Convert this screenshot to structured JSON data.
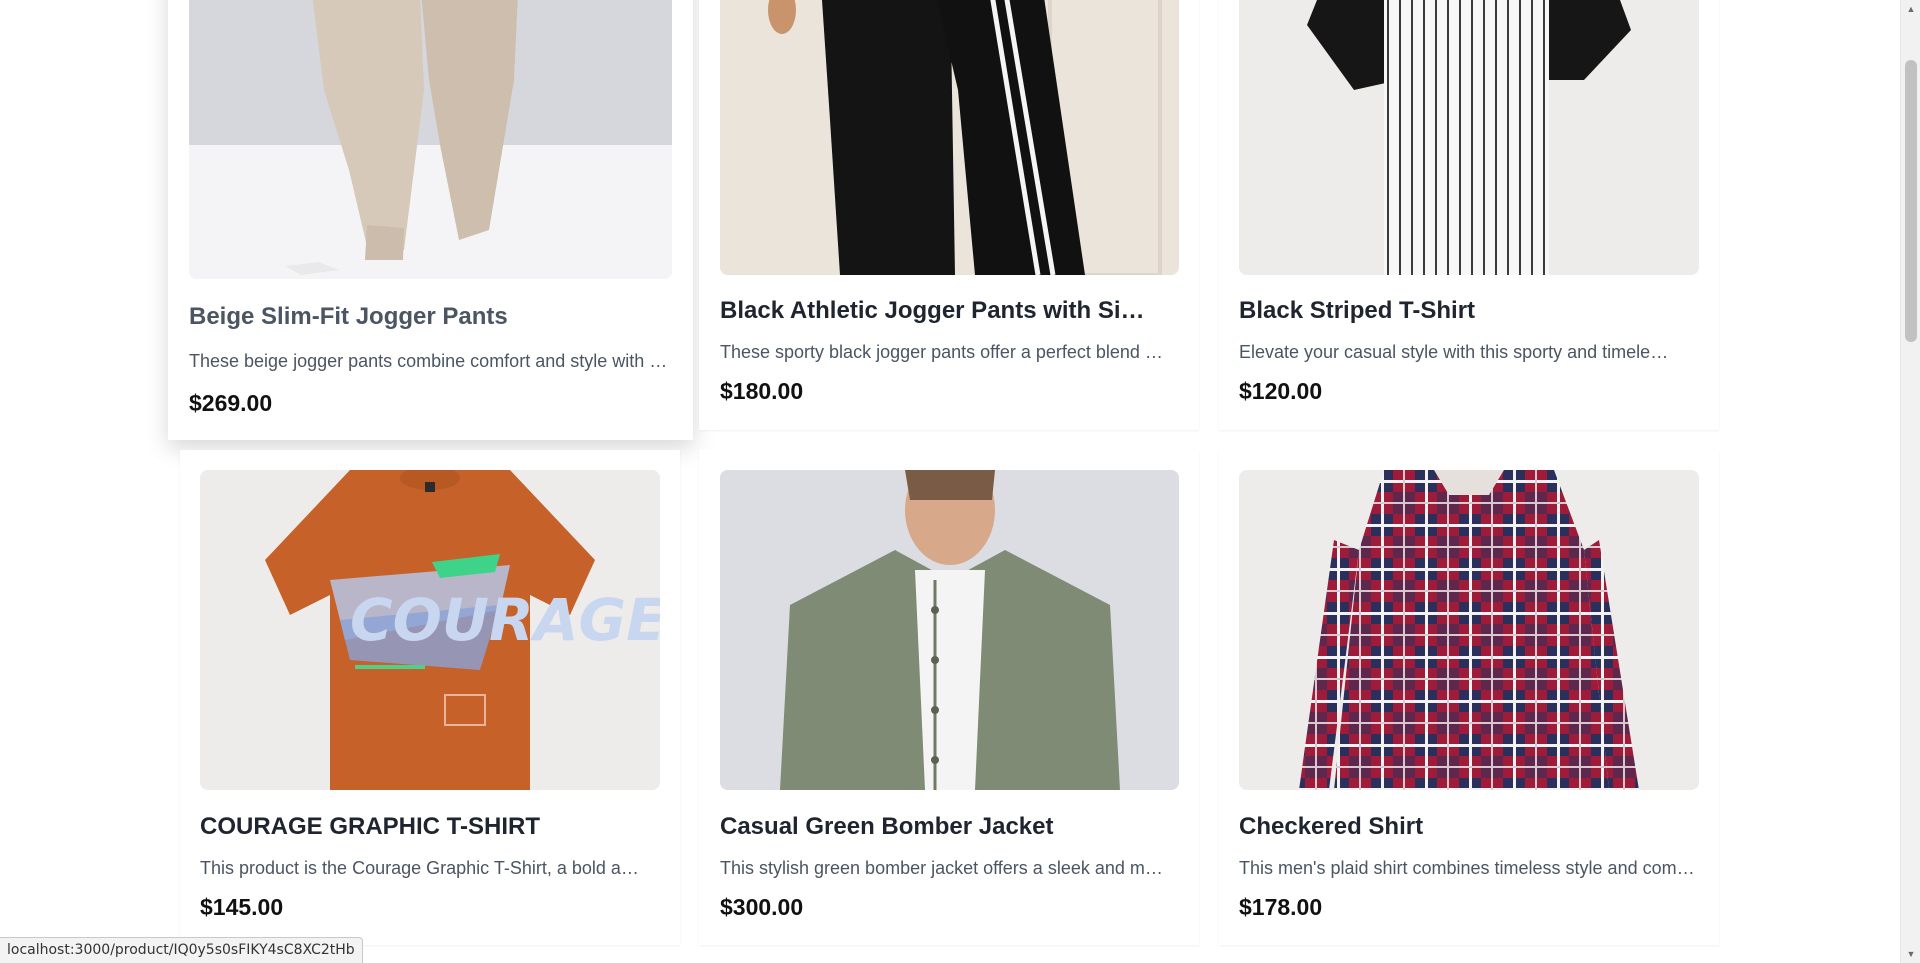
{
  "products": [
    {
      "title": "Beige Slim-Fit Jogger Pants",
      "description": "These beige jogger pants combine comfort and style with a modern slim-fit cut",
      "price": "$269.00",
      "image": "beige-jogger-pants-image"
    },
    {
      "title": "Black Athletic Jogger Pants with Side Stripes",
      "description": "These sporty black jogger pants offer a perfect blend of comfort and style",
      "price": "$180.00",
      "image": "black-athletic-jogger-pants-image"
    },
    {
      "title": "Black Striped T-Shirt",
      "description": "Elevate your casual style with this sporty and timeless striped tee",
      "price": "$120.00",
      "image": "black-striped-tshirt-image"
    },
    {
      "title": "COURAGE GRAPHIC T-SHIRT",
      "description": "This product is the Courage Graphic T-Shirt, a bold and expressive tee",
      "price": "$145.00",
      "image": "courage-graphic-tshirt-image",
      "graphic_text": "COURAGE"
    },
    {
      "title": "Casual Green Bomber Jacket",
      "description": "This stylish green bomber jacket offers a sleek and modern look",
      "price": "$300.00",
      "image": "green-bomber-jacket-image"
    },
    {
      "title": "Checkered Shirt",
      "description": "This men's plaid shirt combines timeless style and comfort for everyday wear",
      "price": "$178.00",
      "image": "checkered-shirt-image"
    }
  ],
  "status_bar": {
    "link_url": "localhost:3000/product/IQ0y5s0sFIKY4sC8XC2tHb"
  },
  "colors": {
    "title": "#1f2530",
    "description": "#4b5563",
    "price": "#111111",
    "image_bg_light": "#eeeceb",
    "image_bg_grey": "#d9dadf",
    "tshirt_orange": "#c6612a",
    "jacket_green": "#7f8b74",
    "plaid_red": "#9e1c3a",
    "plaid_navy": "#2a2f5c"
  }
}
